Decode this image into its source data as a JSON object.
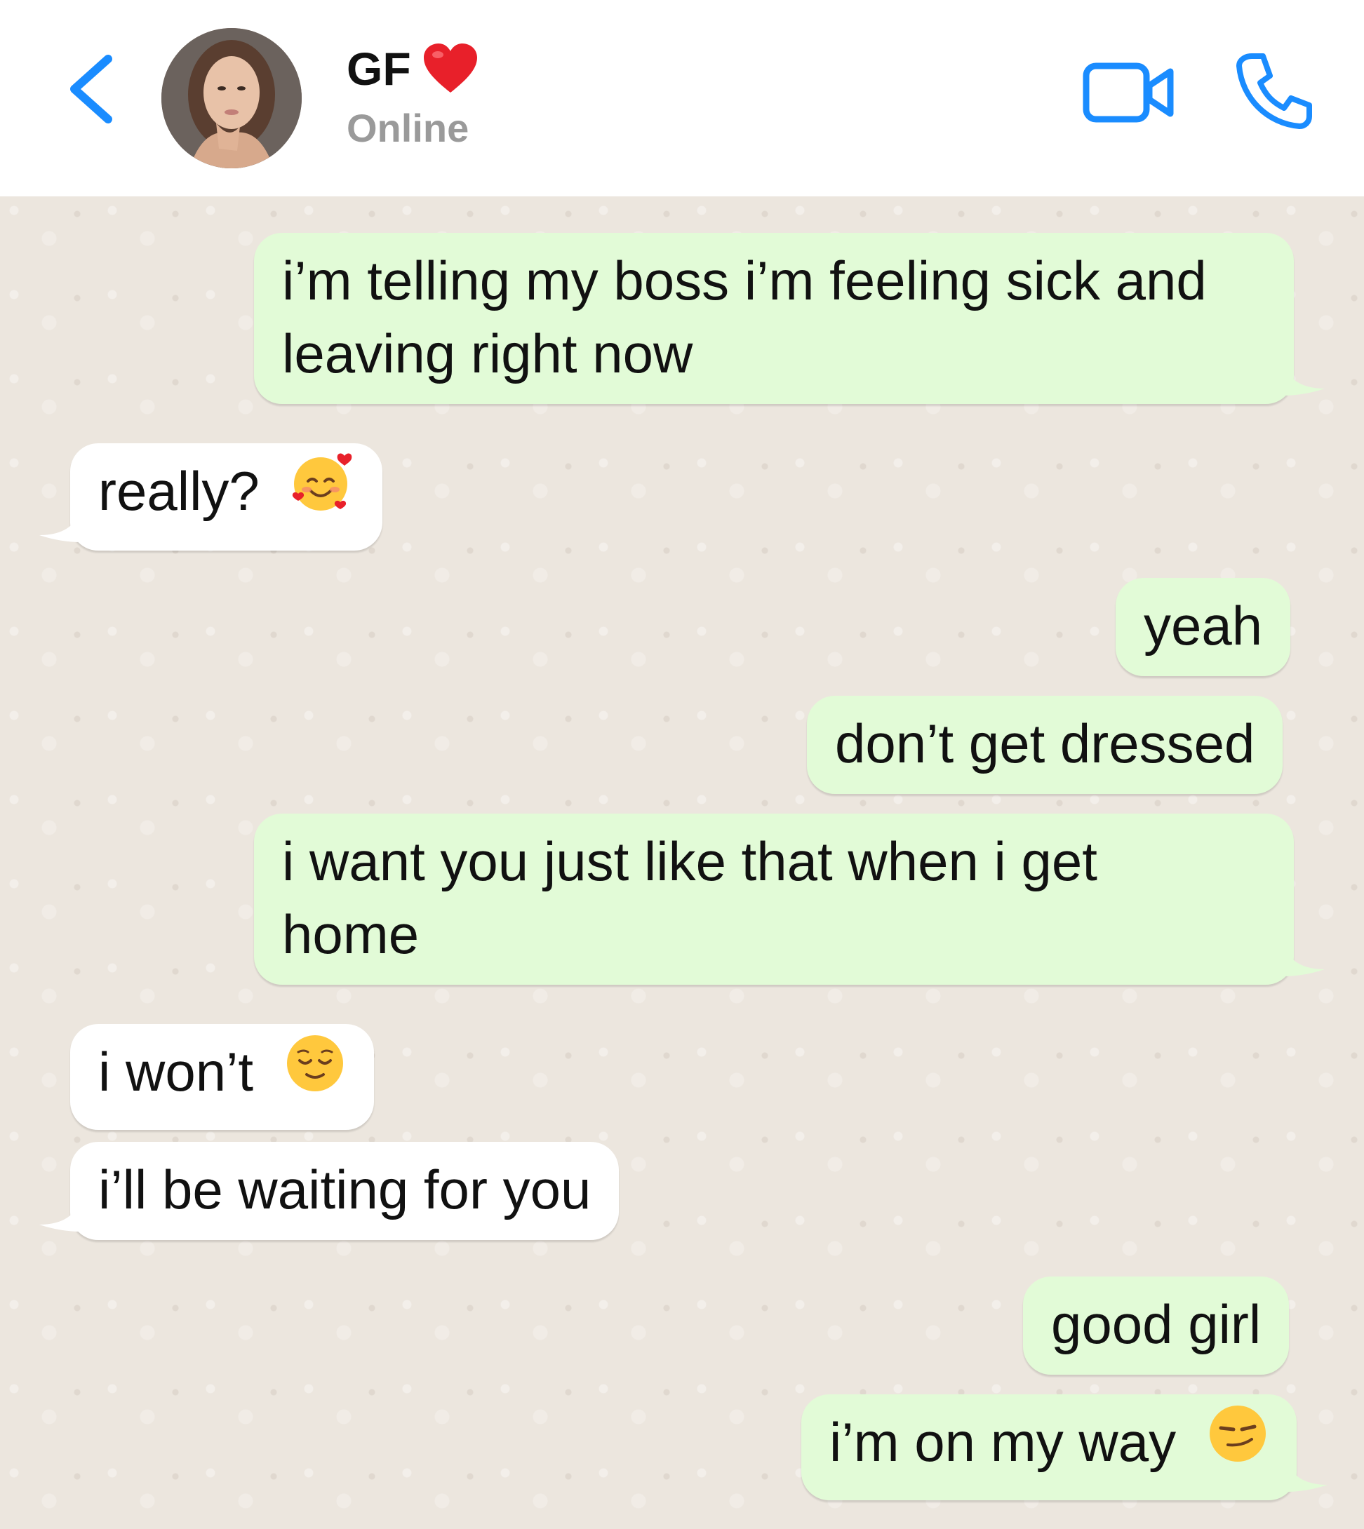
{
  "header": {
    "contact_name": "GF",
    "status": "Online",
    "heart_emoji": "red-heart",
    "icons": [
      "chevron-left-icon",
      "video-camera-icon",
      "phone-icon"
    ],
    "accent_color": "#1a8cff"
  },
  "messages": [
    {
      "direction": "outgoing",
      "line1": "i’m telling my boss i’m feeling sick and",
      "line2": "leaving right now"
    },
    {
      "direction": "incoming",
      "text": "really?",
      "emoji": "smiling-face-with-hearts"
    },
    {
      "direction": "outgoing",
      "text": "yeah"
    },
    {
      "direction": "outgoing",
      "text": "don’t get dressed"
    },
    {
      "direction": "outgoing",
      "line1": "i want you just like that when i get",
      "line2": "home"
    },
    {
      "direction": "incoming",
      "text": "i won’t",
      "emoji": "relieved-face"
    },
    {
      "direction": "incoming",
      "text": "i’ll be waiting for you"
    },
    {
      "direction": "outgoing",
      "text": "good girl"
    },
    {
      "direction": "outgoing",
      "text": "i’m on my way",
      "emoji": "smirking-face"
    }
  ],
  "colors": {
    "outgoing_bubble": "#e2fbd7",
    "incoming_bubble": "#ffffff",
    "chat_background": "#ece6de",
    "status_text": "#9a9a9a"
  }
}
